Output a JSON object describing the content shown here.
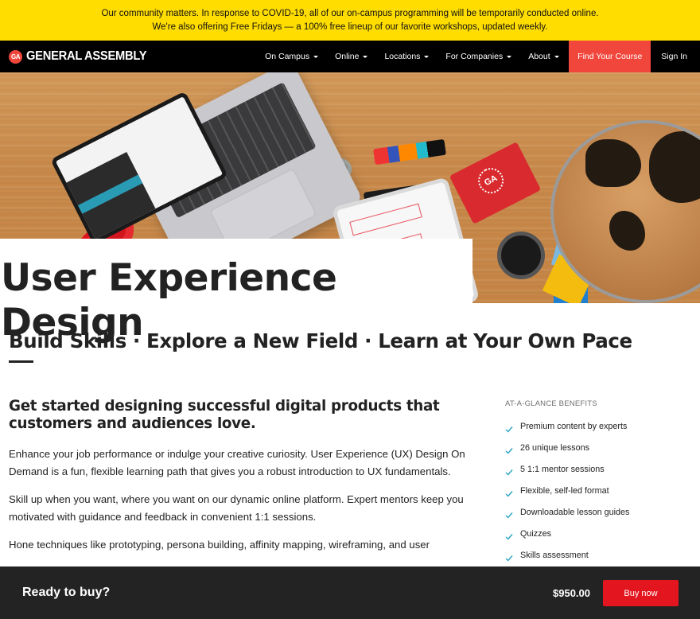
{
  "alert": {
    "line1": "Our community matters. In response to COVID-19, all of our on-campus programming will be temporarily conducted online.",
    "line2": "We're also offering Free Fridays — a 100% free lineup of our favorite workshops, updated weekly."
  },
  "nav": {
    "logo_badge": "GA",
    "logo_text": "GENERAL ASSEMBLY",
    "items": [
      {
        "label": "On Campus",
        "has_dropdown": true
      },
      {
        "label": "Online",
        "has_dropdown": true
      },
      {
        "label": "Locations",
        "has_dropdown": true
      },
      {
        "label": "For Companies",
        "has_dropdown": true
      },
      {
        "label": "About",
        "has_dropdown": true
      }
    ],
    "cta_label": "Find Your Course",
    "signin_label": "Sign In"
  },
  "hero": {
    "image_icon": "desk-workspace-photo",
    "notebook_logo": "GA",
    "title": "User Experience Design"
  },
  "main": {
    "tagline": "Build Skills · Explore a New Field · Learn at Your Own Pace",
    "lede": "Get started designing successful digital products that customers and audiences love.",
    "paragraphs": [
      "Enhance your job performance or indulge your creative curiosity. User Experience (UX) Design On Demand is a fun, flexible learning path that gives you a robust introduction to UX fundamentals.",
      "Skill up when you want, where you want on our dynamic online platform. Expert mentors keep you motivated with guidance and feedback in convenient 1:1 sessions.",
      "Hone techniques like prototyping, persona building, affinity mapping, wireframing, and user"
    ]
  },
  "sidebar": {
    "title": "AT-A-GLANCE BENEFITS",
    "benefits": [
      "Premium content by experts",
      "26 unique lessons",
      "5 1:1 mentor sessions",
      "Flexible, self-led format",
      "Downloadable lesson guides",
      "Quizzes",
      "Skills assessment"
    ]
  },
  "buybar": {
    "question": "Ready to buy?",
    "price": "$950.00",
    "button_label": "Buy now"
  },
  "colors": {
    "alert_bg": "#FFDD00",
    "nav_bg": "#000000",
    "brand_red": "#F0463C",
    "buy_red": "#E3151E",
    "check_teal": "#2AA3C4",
    "buybar_bg": "#232323"
  }
}
